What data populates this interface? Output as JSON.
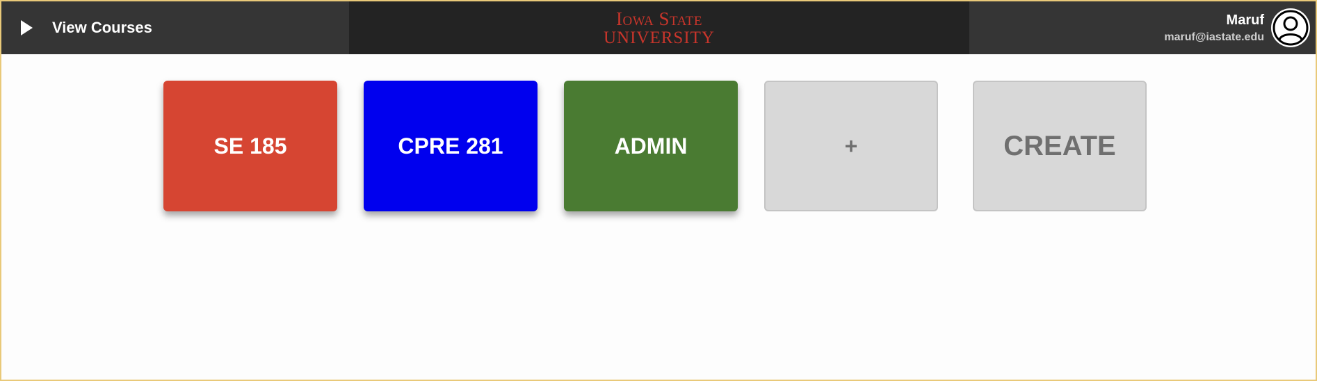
{
  "header": {
    "nav_label": "View Courses",
    "logo_line1": "Iowa State",
    "logo_line2": "University",
    "user_name": "Maruf",
    "user_email": "maruf@iastate.edu"
  },
  "courses": [
    {
      "label": "SE 185",
      "color": "#d64532"
    },
    {
      "label": "CPRE 281",
      "color": "#0000ee"
    },
    {
      "label": "ADMIN",
      "color": "#4a7b32"
    }
  ],
  "actions": {
    "add_label": "+",
    "create_label": "CREATE"
  },
  "icons": {
    "nav": "play-icon",
    "avatar": "user-avatar-icon"
  }
}
